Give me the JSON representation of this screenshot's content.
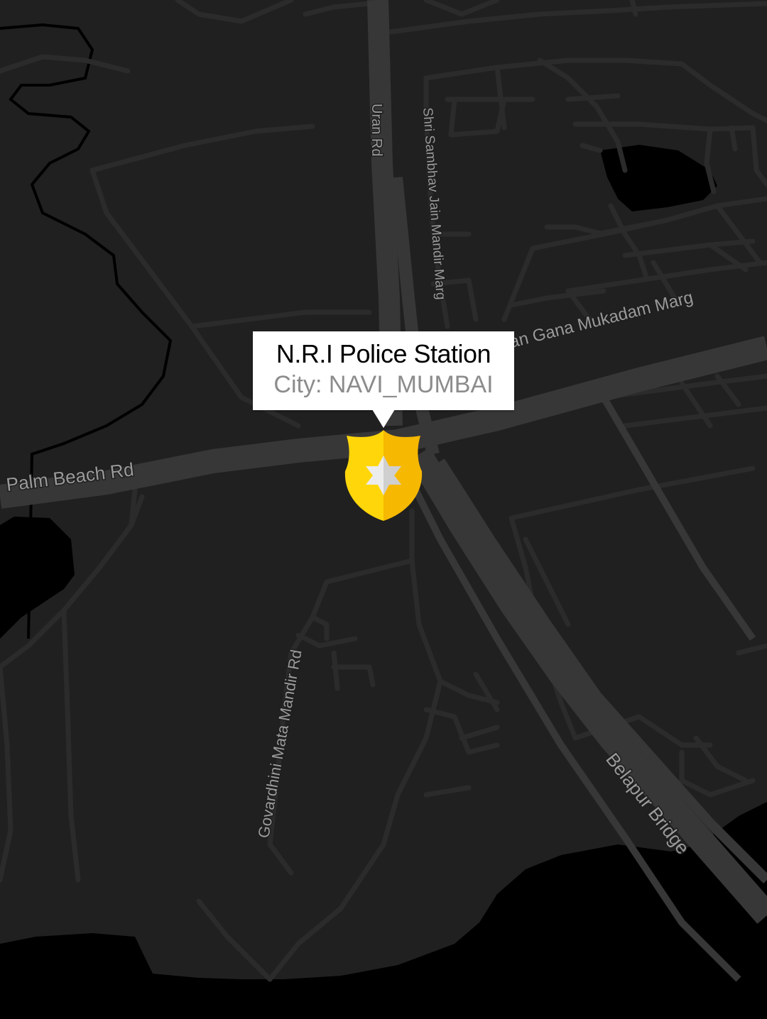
{
  "map": {
    "colors": {
      "water": "#000000",
      "land": "#202020",
      "road_minor": "#2b2b2b",
      "road_major": "#373737",
      "road_label": "#9a9a9a"
    },
    "road_labels": {
      "uran_rd": "Uran Rd",
      "shri_sambhav": "Shri Sambhav Jain Mandir Marg",
      "jan_gana": "Jan Gana Mukadam Marg",
      "palm_beach": "Palm Beach Rd",
      "govardhini": "Govardhini Mata Mandir Rd",
      "belapur_bridge": "Belapur Bridge"
    }
  },
  "callout": {
    "title": "N.R.I Police Station",
    "subtitle": "City: NAVI_MUMBAI"
  },
  "marker": {
    "icon": "police-badge-icon",
    "colors": {
      "badge_left": "#ffd60a",
      "badge_right": "#f6b800",
      "star": "#ececec",
      "star_shade": "#cfcfcf"
    }
  }
}
